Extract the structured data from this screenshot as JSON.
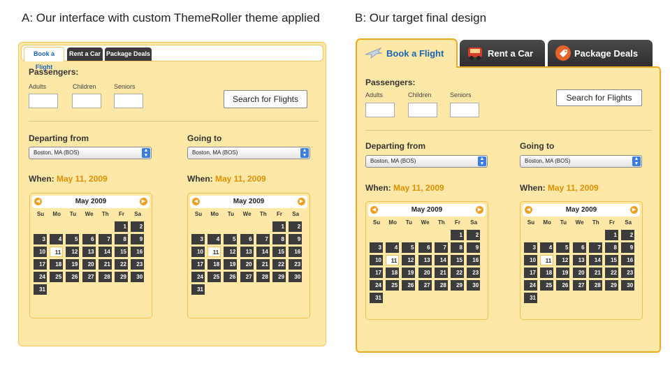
{
  "captions": {
    "a": "A: Our interface with custom ThemeRoller theme applied",
    "b": "B: Our target final design"
  },
  "tabs": [
    "Book a Flight",
    "Rent a Car",
    "Package Deals"
  ],
  "form": {
    "passengers_label": "Passengers:",
    "adults_label": "Adults",
    "children_label": "Children",
    "seniors_label": "Seniors",
    "search_button": "Search for Flights",
    "departing_label": "Departing from",
    "going_label": "Going to",
    "departing_value": "Boston, MA (BOS)",
    "going_value": "Boston, MA (BOS)",
    "when_label": "When:",
    "when_date": "May 11, 2009"
  },
  "calendar": {
    "month_title": "May 2009",
    "prev_icon": "prev-arrow-icon",
    "next_icon": "next-arrow-icon",
    "weekdays": [
      "Su",
      "Mo",
      "Tu",
      "We",
      "Th",
      "Fr",
      "Sa"
    ],
    "first_weekday": 5,
    "days_in_month": 31,
    "selected_day": 11
  },
  "colors": {
    "panel_bg": "#fde8a8",
    "border": "#f0a820",
    "tab_active_text": "#1a63b5",
    "tab_inactive_bg": "#3a3a3a",
    "date_accent": "#e08f00",
    "day_cell": "#3c3c3c"
  },
  "icons": {
    "flight_tab": "airplane-icon",
    "car_tab": "car-icon",
    "package_tab": "tag-icon"
  }
}
